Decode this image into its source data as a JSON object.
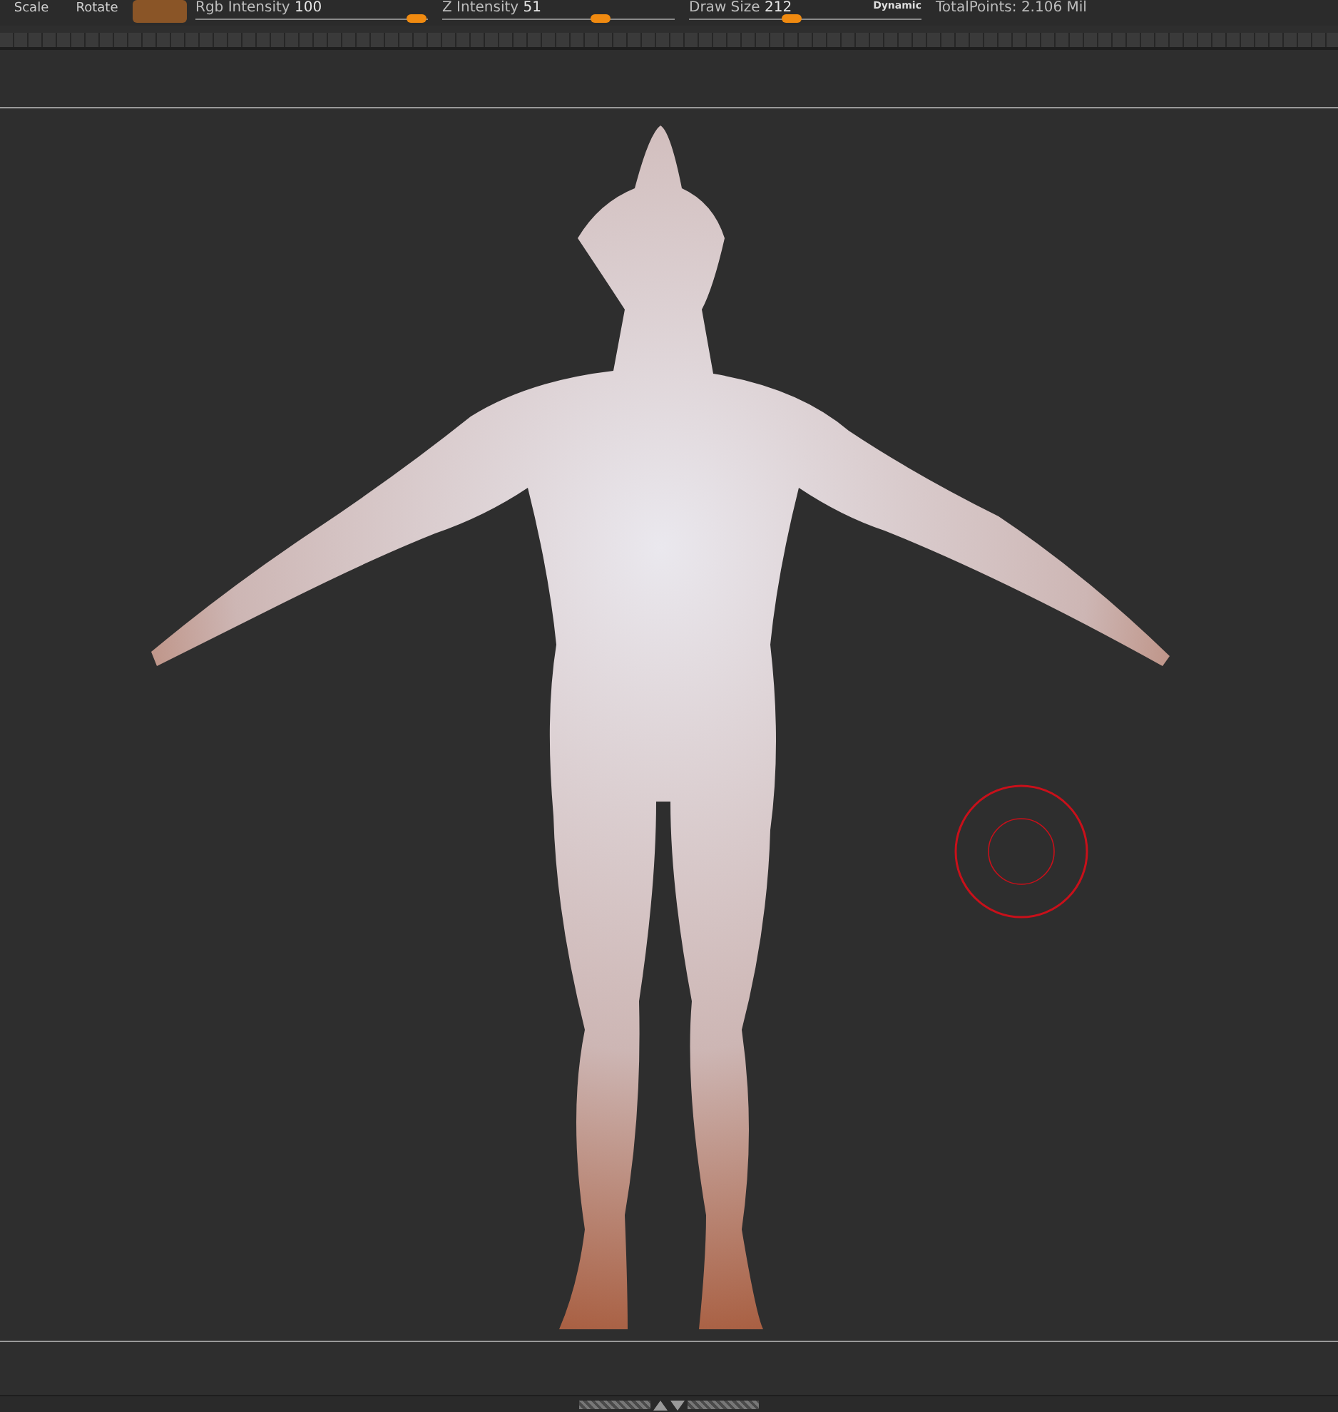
{
  "toolbar": {
    "tools": [
      {
        "label": "Scale"
      },
      {
        "label": "Rotate"
      }
    ],
    "sliders": [
      {
        "label": "Rgb Intensity",
        "value": "100",
        "level": 0.95
      },
      {
        "label": "Z Intensity",
        "value": "51",
        "level": 0.68
      },
      {
        "label": "Draw Size",
        "value": "212",
        "level": 0.44,
        "badge": "Dynamic"
      }
    ],
    "total_points": "TotalPoints: 2.106 Mil"
  }
}
